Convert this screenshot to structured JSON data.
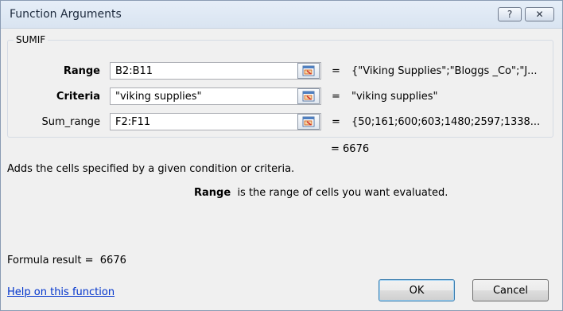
{
  "window": {
    "title": "Function Arguments",
    "help_glyph": "?",
    "close_glyph": "✕"
  },
  "function_name": "SUMIF",
  "arguments": [
    {
      "label": "Range",
      "value": "B2:B11",
      "result": "{\"Viking Supplies\";\"Bloggs _Co\";\"J..."
    },
    {
      "label": "Criteria",
      "value": "\"viking supplies\"",
      "result": "\"viking supplies\""
    },
    {
      "label": "Sum_range",
      "value": "F2:F11",
      "result": "{50;161;600;603;1480;2597;1338..."
    }
  ],
  "equals": "=",
  "function_result": "= 6676",
  "description": "Adds the cells specified by a given condition or criteria.",
  "arg_help": {
    "name": "Range",
    "text": "is the range of cells you want evaluated."
  },
  "formula_result": {
    "label": "Formula result =",
    "value": "6676"
  },
  "help_link": "Help on this function",
  "buttons": {
    "ok": "OK",
    "cancel": "Cancel"
  },
  "icons": [
    "help-icon",
    "close-icon",
    "collapse-dialog-icon"
  ]
}
